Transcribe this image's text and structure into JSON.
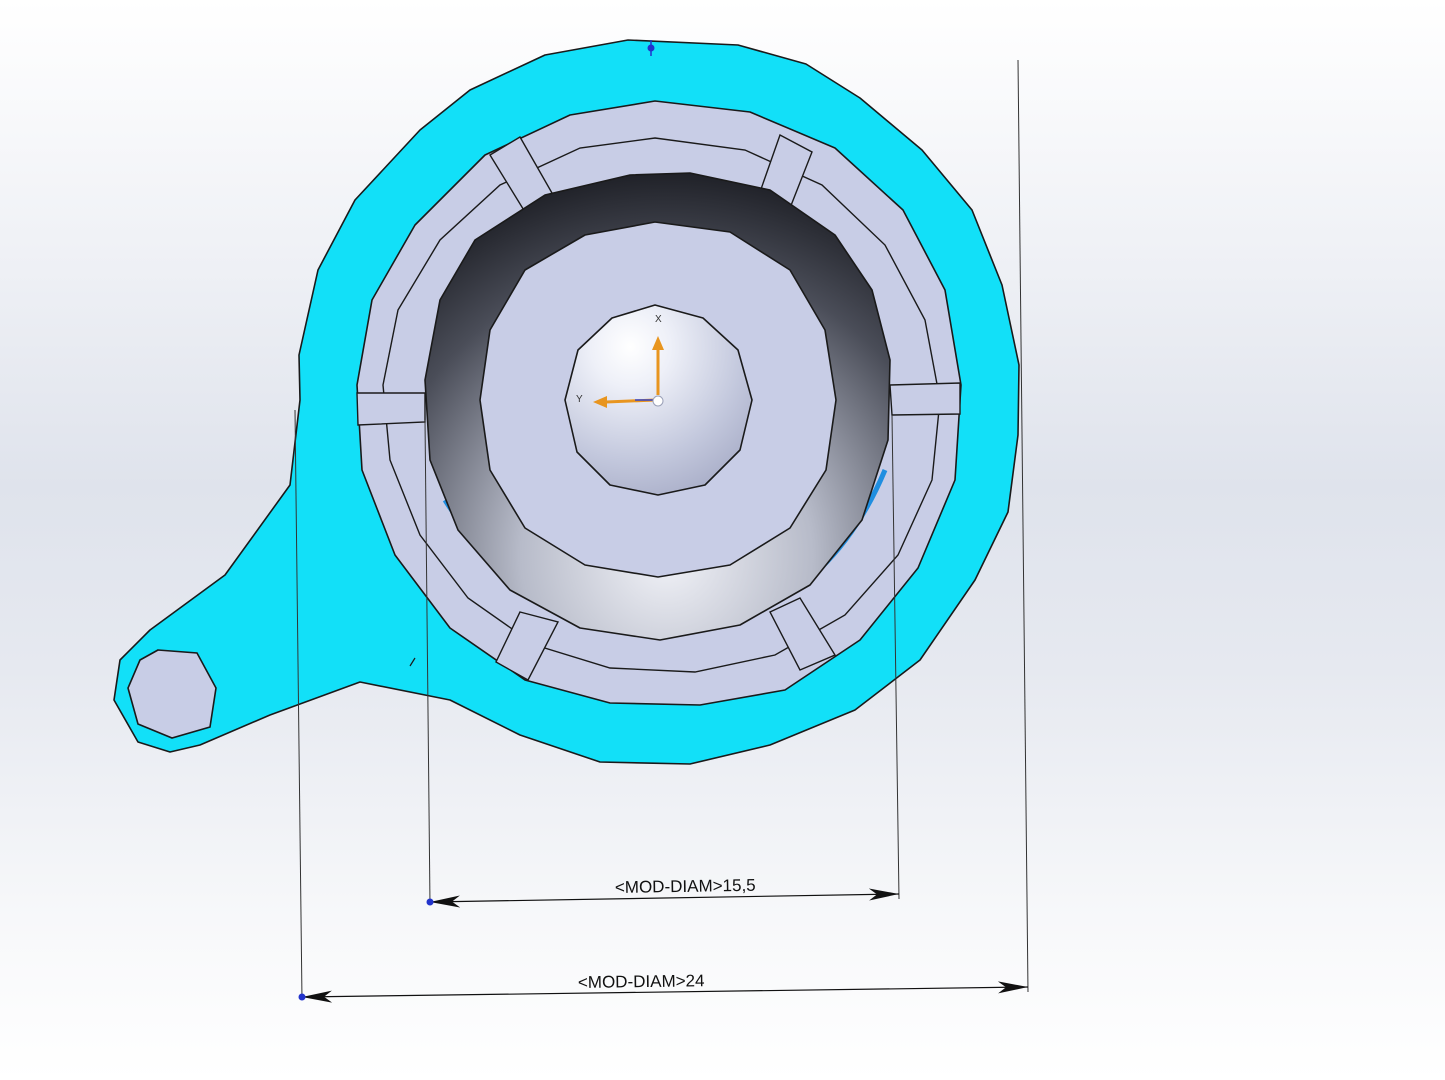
{
  "viewport": {
    "triad": {
      "x_label": "X",
      "y_label": "Y"
    },
    "dimensions": [
      {
        "id": "inner",
        "text": "<MOD-DIAM>15,5"
      },
      {
        "id": "outer",
        "text": "<MOD-DIAM>24"
      }
    ]
  },
  "colors": {
    "selected_face": "#12e0f8",
    "face": "#c8cde6",
    "edge": "#1a1a1a",
    "axis_arrow": "#e8951f",
    "dimension_point": "#2233cc"
  }
}
